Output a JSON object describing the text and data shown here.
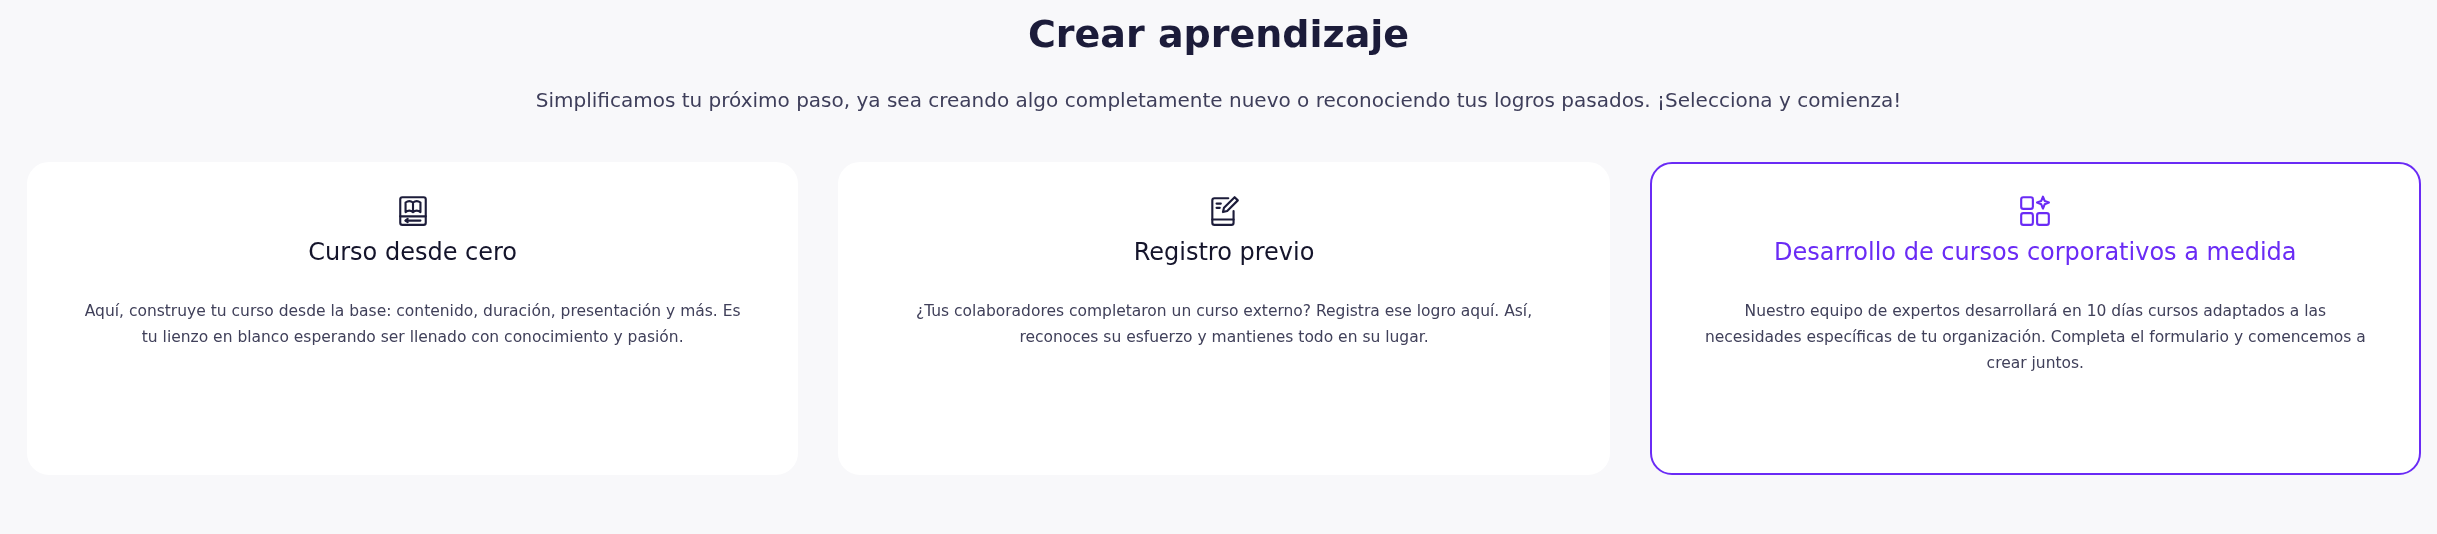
{
  "header": {
    "title": "Crear aprendizaje",
    "subtitle": "Simplificamos tu próximo paso, ya sea creando algo completamente nuevo o reconociendo tus logros pasados. ¡Selecciona y comienza!"
  },
  "cards": [
    {
      "kind": "book",
      "title": "Curso desde cero",
      "description": "Aquí, construye tu curso desde la base: contenido, duración, presentación y más. Es tu lienzo en blanco esperando ser llenado con conocimiento y pasión.",
      "selected": false
    },
    {
      "kind": "edit",
      "title": "Registro previo",
      "description": "¿Tus colaboradores completaron un curso externo? Registra ese logro aquí. Así, reconoces su esfuerzo y mantienes todo en su lugar.",
      "selected": false
    },
    {
      "kind": "apps",
      "title": "Desarrollo de cursos corporativos a medida",
      "description": "Nuestro equipo de expertos desarrollará en 10 días cursos adaptados a las necesidades específicas de tu organización. Completa el formulario y comencemos a crear juntos.",
      "selected": true
    }
  ]
}
